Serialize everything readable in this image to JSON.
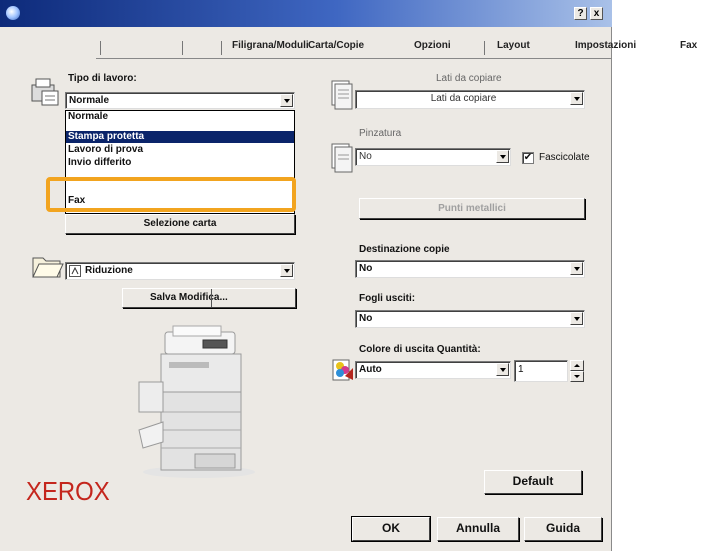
{
  "titlebar": {
    "help_label": "?",
    "close_label": "x"
  },
  "tabs": [
    {
      "label": ""
    },
    {
      "label": ""
    },
    {
      "label": "Filigrana/Moduli"
    },
    {
      "label": "Carta/Copie"
    },
    {
      "label": "Opzioni"
    },
    {
      "label": "Layout"
    },
    {
      "label": "Impostazioni"
    },
    {
      "label": "Fax"
    }
  ],
  "left": {
    "job_type_label": "Tipo di lavoro:",
    "job_type_value": "Normale",
    "job_type_options": [
      "Normale",
      "Stampa protetta",
      "Lavoro di prova",
      "Invio differito",
      "",
      "Fax"
    ],
    "job_type_selected_index": 1,
    "paper_button": "Selezione carta",
    "preset_value": "Riduzione",
    "save_button": "Salva Modifica...",
    "logo_text": "XEROX"
  },
  "right": {
    "sides_label": "Lati da copiare",
    "sides_value": "Lati da copiare",
    "stapling_label": "Pinzatura",
    "stapling_value": "No",
    "collate_label": "Fascicolate",
    "collate_checked": "✔",
    "staples_button": "Punti metallici",
    "destination_label": "Destinazione copie",
    "destination_value": "No",
    "separators_label": "Fogli usciti:",
    "separators_value": "No",
    "color_label": "Colore di uscita Quantità:",
    "color_value": "Auto",
    "quantity_value": "1",
    "default_button": "Default"
  },
  "footer": {
    "ok": "OK",
    "cancel": "Annulla",
    "help": "Guida"
  },
  "colors": {
    "title_start": "#0d2a7a",
    "title_end": "#a9c1e8",
    "highlight": "#f2a41f",
    "selection": "#0a246a",
    "logo": "#c4261d"
  }
}
